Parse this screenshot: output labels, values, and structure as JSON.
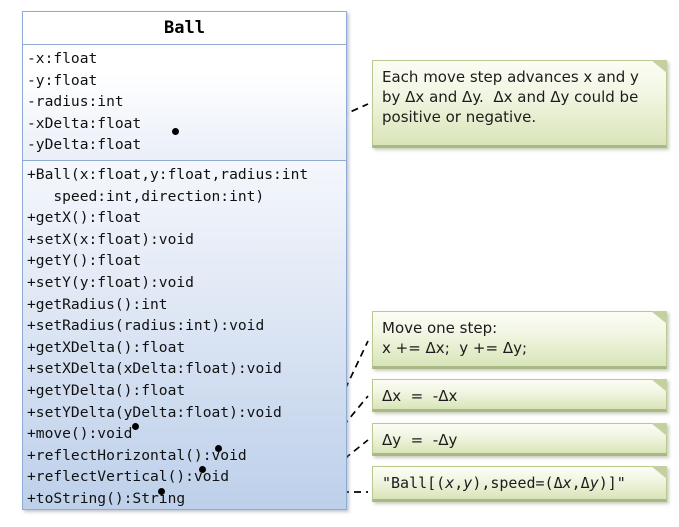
{
  "diagram": {
    "type": "uml-class-diagram",
    "class": {
      "name": "Ball",
      "attributes": [
        "-x:float",
        "-y:float",
        "-radius:int",
        "-xDelta:float",
        "-yDelta:float"
      ],
      "methods": [
        "+Ball(x:float,y:float,radius:int",
        "speed:int,direction:int)",
        "+getX():float",
        "+setX(x:float):void",
        "+getY():float",
        "+setY(y:float):void",
        "+getRadius():int",
        "+setRadius(radius:int):void",
        "+getXDelta():float",
        "+setXDelta(xDelta:float):void",
        "+getYDelta():float",
        "+setYDelta(yDelta:float):void",
        "+move():void",
        "+reflectHorizontal():void",
        "+reflectVertical():void",
        "+toString():String"
      ]
    },
    "notes": {
      "move_semantics": {
        "lines": [
          "Each move step advances x and y",
          "by Δx and Δy.  Δx and Δy could be",
          "positive or negative."
        ]
      },
      "move_step": {
        "lines": [
          "Move one step:",
          "x += Δx;  y += Δy;"
        ]
      },
      "reflect_horizontal": {
        "lines": [
          "Δx  =  -Δx"
        ]
      },
      "reflect_vertical": {
        "lines": [
          "Δy  =  -Δy"
        ]
      },
      "to_string": {
        "prefix": "\"Ball[(",
        "x": "x",
        "comma": ",",
        "y": "y",
        "mid": "),speed=(Δ",
        "x2": "x",
        "comma2": ",Δ",
        "y2": "y",
        "suffix": ")]\""
      }
    },
    "colors": {
      "class_border": "#8faad4",
      "class_body_top": "#ffffff",
      "class_body_bottom": "#bed0ea",
      "note_border": "#b9c98f",
      "note_fill": "#e2ebc8",
      "connector": "#000000"
    }
  }
}
